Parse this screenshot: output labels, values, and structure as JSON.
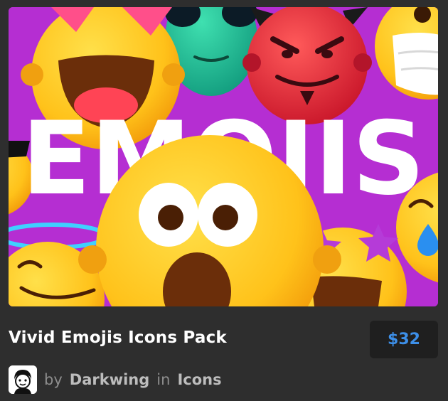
{
  "product": {
    "title": "Vivid Emojis Icons Pack",
    "price": "$32",
    "by_label": "by",
    "author": "Darkwing",
    "in_label": "in",
    "category": "Icons",
    "thumbnail_text": "EMOJIS"
  },
  "colors": {
    "background": "#2e2e2e",
    "price_text": "#3d8fe8",
    "thumbnail_bg": "#b52ed2"
  }
}
